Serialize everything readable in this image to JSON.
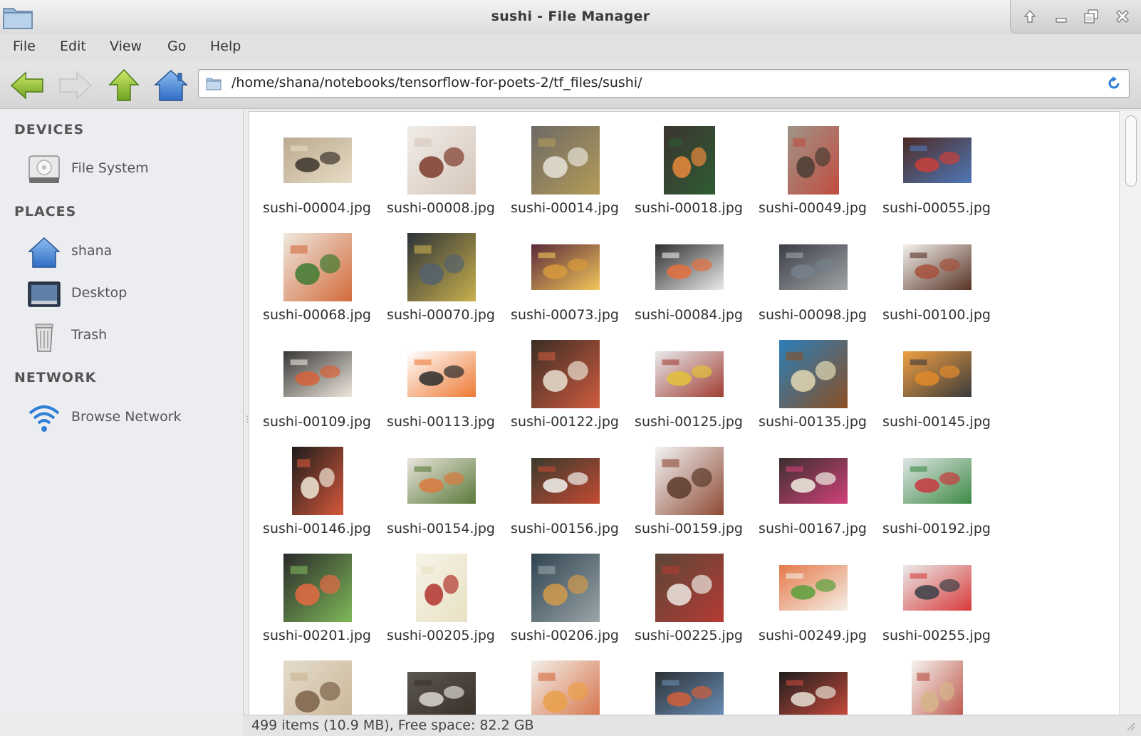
{
  "window": {
    "title": "sushi - File Manager",
    "wm_buttons": [
      "raise-icon",
      "minimize-icon",
      "restore-icon",
      "close-icon"
    ]
  },
  "menu": {
    "items": [
      "File",
      "Edit",
      "View",
      "Go",
      "Help"
    ]
  },
  "toolbar": {
    "buttons": [
      "back-arrow-icon",
      "forward-arrow-icon",
      "up-arrow-icon",
      "home-icon"
    ],
    "location": "/home/shana/notebooks/tensorflow-for-poets-2/tf_files/sushi/"
  },
  "sidebar": {
    "sections": [
      {
        "heading": "DEVICES",
        "items": [
          {
            "label": "File System",
            "icon": "hard-drive-icon"
          }
        ]
      },
      {
        "heading": "PLACES",
        "items": [
          {
            "label": "shana",
            "icon": "home-icon"
          },
          {
            "label": "Desktop",
            "icon": "desktop-icon"
          },
          {
            "label": "Trash",
            "icon": "trash-icon"
          }
        ]
      },
      {
        "heading": "NETWORK",
        "items": [
          {
            "label": "Browse Network",
            "icon": "wifi-icon"
          }
        ]
      }
    ]
  },
  "files": [
    {
      "name": "sushi-00004.jpg",
      "shape": "wide",
      "colors": [
        "#b9a98f",
        "#3c342c",
        "#e8dcc6"
      ]
    },
    {
      "name": "sushi-00008.jpg",
      "shape": "square",
      "colors": [
        "#f1ece8",
        "#7d3b2a",
        "#d6c7bb"
      ]
    },
    {
      "name": "sushi-00014.jpg",
      "shape": "square",
      "colors": [
        "#6e6a66",
        "#e7e3d8",
        "#b39b58"
      ]
    },
    {
      "name": "sushi-00018.jpg",
      "shape": "tall",
      "colors": [
        "#3b3430",
        "#e98a3c",
        "#2f5c33"
      ]
    },
    {
      "name": "sushi-00049.jpg",
      "shape": "tall",
      "colors": [
        "#9f9488",
        "#4a3d35",
        "#c24c3f"
      ]
    },
    {
      "name": "sushi-00055.jpg",
      "shape": "wide",
      "colors": [
        "#4d2a24",
        "#c8403a",
        "#4f78b8"
      ]
    },
    {
      "name": "sushi-00068.jpg",
      "shape": "square",
      "colors": [
        "#efe8de",
        "#3f7b31",
        "#d26a3a"
      ]
    },
    {
      "name": "sushi-00070.jpg",
      "shape": "square",
      "colors": [
        "#2d3238",
        "#54626e",
        "#c8b04c"
      ]
    },
    {
      "name": "sushi-00073.jpg",
      "shape": "wide",
      "colors": [
        "#5a2a3a",
        "#d79a3c",
        "#f2c65a"
      ]
    },
    {
      "name": "sushi-00084.jpg",
      "shape": "wide",
      "colors": [
        "#2f2f2f",
        "#e4703e",
        "#eaeaea"
      ]
    },
    {
      "name": "sushi-00098.jpg",
      "shape": "wide",
      "colors": [
        "#3b3d44",
        "#76808c",
        "#a0a4a8"
      ]
    },
    {
      "name": "sushi-00100.jpg",
      "shape": "wide",
      "colors": [
        "#f3f0ec",
        "#a4513c",
        "#573224"
      ]
    },
    {
      "name": "sushi-00109.jpg",
      "shape": "wide",
      "colors": [
        "#383838",
        "#d6613a",
        "#ede6dc"
      ]
    },
    {
      "name": "sushi-00113.jpg",
      "shape": "wide",
      "colors": [
        "#ffffff",
        "#2b2b2b",
        "#ee7a35"
      ]
    },
    {
      "name": "sushi-00122.jpg",
      "shape": "square",
      "colors": [
        "#3a2d24",
        "#e9e1d1",
        "#cf5b3f"
      ]
    },
    {
      "name": "sushi-00125.jpg",
      "shape": "wide",
      "colors": [
        "#e8e8ea",
        "#e3c23a",
        "#a13f34"
      ]
    },
    {
      "name": "sushi-00135.jpg",
      "shape": "square",
      "colors": [
        "#2b7fb8",
        "#e4d8b4",
        "#8a4f24"
      ]
    },
    {
      "name": "sushi-00145.jpg",
      "shape": "wide",
      "colors": [
        "#f0a042",
        "#e08a2c",
        "#3b3b3b"
      ]
    },
    {
      "name": "sushi-00146.jpg",
      "shape": "tall",
      "colors": [
        "#1c1c1c",
        "#efe7d6",
        "#d6583b"
      ]
    },
    {
      "name": "sushi-00154.jpg",
      "shape": "wide",
      "colors": [
        "#e9e4dc",
        "#d97a3e",
        "#5a7a3a"
      ]
    },
    {
      "name": "sushi-00156.jpg",
      "shape": "wide",
      "colors": [
        "#3a3a2e",
        "#f2f2ee",
        "#c34a32"
      ]
    },
    {
      "name": "sushi-00159.jpg",
      "shape": "square",
      "colors": [
        "#f4f4f4",
        "#5b3a2a",
        "#8e4a35"
      ]
    },
    {
      "name": "sushi-00167.jpg",
      "shape": "wide",
      "colors": [
        "#3b2f2e",
        "#f1ede2",
        "#d1417a"
      ]
    },
    {
      "name": "sushi-00192.jpg",
      "shape": "wide",
      "colors": [
        "#dfe5e4",
        "#c73a3f",
        "#3d8a45"
      ]
    },
    {
      "name": "sushi-00201.jpg",
      "shape": "square",
      "colors": [
        "#2a2a2a",
        "#e56a44",
        "#7fb85a"
      ]
    },
    {
      "name": "sushi-00205.jpg",
      "shape": "tall",
      "colors": [
        "#f7f4e8",
        "#b2342e",
        "#e8e1c4"
      ]
    },
    {
      "name": "sushi-00206.jpg",
      "shape": "square",
      "colors": [
        "#2f4350",
        "#d19a4a",
        "#9aa5a8"
      ]
    },
    {
      "name": "sushi-00225.jpg",
      "shape": "square",
      "colors": [
        "#5a4638",
        "#ede8e0",
        "#b53a34"
      ]
    },
    {
      "name": "sushi-00249.jpg",
      "shape": "wide",
      "colors": [
        "#e5794a",
        "#5aa03c",
        "#f4efe6"
      ]
    },
    {
      "name": "sushi-00255.jpg",
      "shape": "wide",
      "colors": [
        "#eaeaea",
        "#3a4046",
        "#d83a3a"
      ]
    },
    {
      "name": "",
      "shape": "square",
      "colors": [
        "#e4dccd",
        "#7b6249",
        "#c9b493"
      ]
    },
    {
      "name": "",
      "shape": "wide",
      "colors": [
        "#5a5650",
        "#dcd7cf",
        "#3a3028"
      ]
    },
    {
      "name": "",
      "shape": "square",
      "colors": [
        "#f2efea",
        "#e9a04a",
        "#d4693c"
      ]
    },
    {
      "name": "",
      "shape": "wide",
      "colors": [
        "#2d3236",
        "#d0603c",
        "#6a8fb8"
      ]
    },
    {
      "name": "",
      "shape": "wide",
      "colors": [
        "#1e1e1e",
        "#e8e0d4",
        "#c94a3c"
      ]
    },
    {
      "name": "",
      "shape": "tall",
      "colors": [
        "#f6f3ee",
        "#d6b58a",
        "#b84a3e"
      ]
    }
  ],
  "status": {
    "text": "499 items (10.9 MB), Free space: 82.2 GB"
  }
}
